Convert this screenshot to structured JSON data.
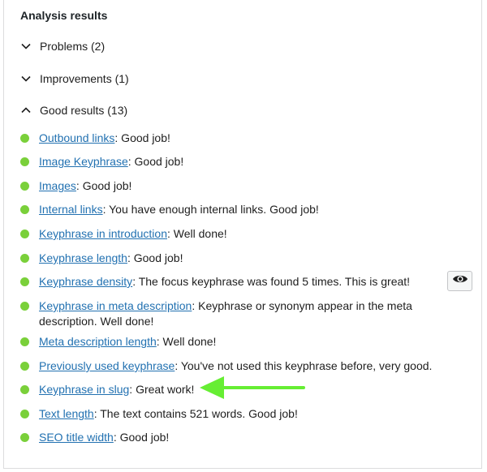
{
  "panel": {
    "heading": "Analysis results"
  },
  "sections": {
    "problems": {
      "label": "Problems (2)",
      "state": "collapsed"
    },
    "improvements": {
      "label": "Improvements (1)",
      "state": "collapsed"
    },
    "good": {
      "label": "Good results (13)",
      "state": "expanded"
    }
  },
  "good_results": [
    {
      "link": "Outbound links",
      "text": ": Good job!"
    },
    {
      "link": "Image Keyphrase",
      "text": ": Good job!"
    },
    {
      "link": "Images",
      "text": ": Good job!"
    },
    {
      "link": "Internal links",
      "text": ": You have enough internal links. Good job!"
    },
    {
      "link": "Keyphrase in introduction",
      "text": ": Well done!"
    },
    {
      "link": "Keyphrase length",
      "text": ": Good job!"
    },
    {
      "link": "Keyphrase density",
      "text": ": The focus keyphrase was found 5 times. This is great!"
    },
    {
      "link": "Keyphrase in meta description",
      "text": ": Keyphrase or synonym appear in the meta description. Well done!"
    },
    {
      "link": "Meta description length",
      "text": ": Well done!"
    },
    {
      "link": "Previously used keyphrase",
      "text": ": You've not used this keyphrase before, very good."
    },
    {
      "link": "Keyphrase in slug",
      "text": ": Great work!"
    },
    {
      "link": "Text length",
      "text": ": The text contains 521 words. Good job!"
    },
    {
      "link": "SEO title width",
      "text": ": Good job!"
    }
  ],
  "icons": {
    "bullet": "good-result-dot",
    "eye": "eye-icon",
    "arrow": "annotation-arrow"
  },
  "colors": {
    "good_bullet": "#7ad03a",
    "link": "#2271b1",
    "annotation_arrow": "#66ee33"
  }
}
